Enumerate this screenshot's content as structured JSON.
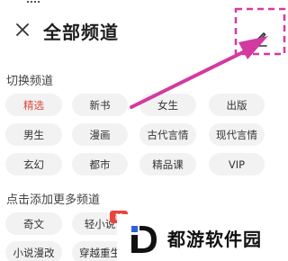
{
  "header": {
    "title": "全部频道",
    "close_icon": "close-icon",
    "edit_icon": "pencil-icon"
  },
  "sections": {
    "switch_title": "切换频道",
    "more_title": "点击添加更多频道"
  },
  "channels": [
    "精选",
    "新书",
    "女生",
    "出版",
    "男生",
    "漫画",
    "古代言情",
    "现代言情",
    "玄幻",
    "都市",
    "精品课",
    "VIP"
  ],
  "more_channels": [
    "奇文",
    "轻小说",
    "小说漫改",
    "穿越重生"
  ],
  "selected_channel": "精选",
  "badge": "新",
  "watermark": {
    "text": "都游软件园",
    "logo_icon": "d-logo-icon"
  },
  "colors": {
    "selected": "#e0463e",
    "arrow": "#d33aa0",
    "chip_bg": "#f2f2f2",
    "badge": "#e8453c",
    "logo": "#2f5fe0"
  }
}
